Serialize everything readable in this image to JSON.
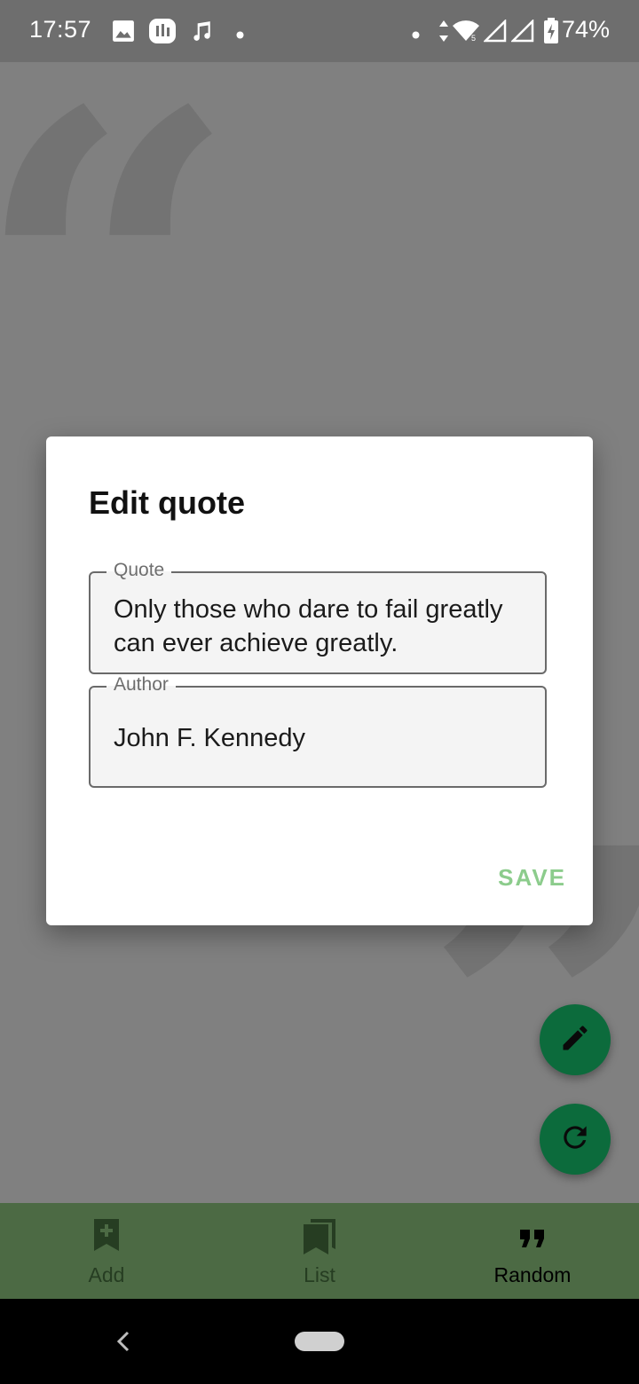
{
  "status_bar": {
    "time": "17:57",
    "battery": "74%",
    "icons": [
      "image-icon",
      "app-icon",
      "music-note-icon",
      "dot-icon",
      "data-arrows-icon",
      "wifi-icon",
      "signal-icon",
      "battery-charging-icon"
    ]
  },
  "dialog": {
    "title": "Edit quote",
    "quote_field": {
      "label": "Quote",
      "value": "Only those who dare to fail greatly can ever achieve greatly."
    },
    "author_field": {
      "label": "Author",
      "value": "John F. Kennedy"
    },
    "save_label": "SAVE"
  },
  "fabs": {
    "edit": "pencil-icon",
    "refresh": "refresh-icon"
  },
  "bottom_nav": {
    "items": [
      {
        "label": "Add",
        "icon": "bookmark-add-icon",
        "active": false
      },
      {
        "label": "List",
        "icon": "bookmarks-icon",
        "active": false
      },
      {
        "label": "Random",
        "icon": "quote-icon",
        "active": true
      }
    ]
  },
  "colors": {
    "accent": "#0c6b3c",
    "save": "#8ccc8c",
    "nav_bg": "#4c6a44"
  }
}
